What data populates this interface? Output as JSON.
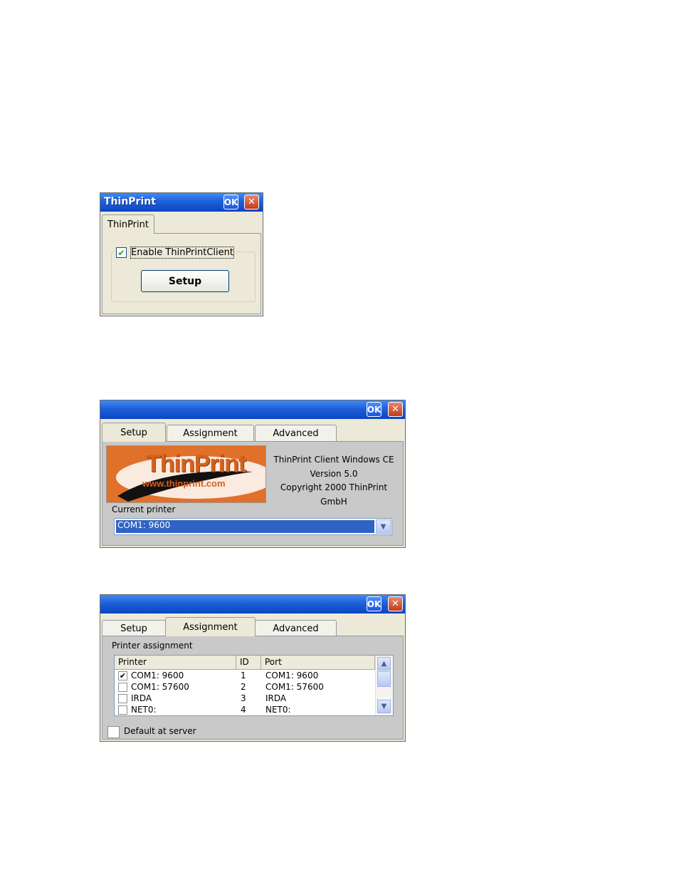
{
  "dialog1": {
    "title": "ThinPrint",
    "ok_label": "OK",
    "close_glyph": "✕",
    "tab_label": "ThinPrint",
    "enable_label": "Enable ThinPrintClient",
    "enable_checked": true,
    "check_glyph": "✔",
    "setup_button": "Setup"
  },
  "dialog2": {
    "ok_label": "OK",
    "close_glyph": "✕",
    "tabs": [
      {
        "label": "Setup"
      },
      {
        "label": "Assignment"
      },
      {
        "label": "Advanced"
      }
    ],
    "active_tab": "Setup",
    "logo_text": "ThinPrint",
    "logo_url": "www.thinprint.com",
    "info_lines": [
      "ThinPrint Client Windows CE",
      "Version 5.0",
      "Copyright 2000 ThinPrint GmbH"
    ],
    "current_printer_label": "Current printer",
    "current_printer_value": "COM1: 9600",
    "dropdown_glyph": "▼"
  },
  "dialog3": {
    "ok_label": "OK",
    "close_glyph": "✕",
    "tabs": [
      {
        "label": "Setup"
      },
      {
        "label": "Assignment"
      },
      {
        "label": "Advanced"
      }
    ],
    "active_tab": "Assignment",
    "group_label": "Printer assignment",
    "columns": [
      "Printer",
      "ID",
      "Port"
    ],
    "rows": [
      {
        "checked": true,
        "printer": "COM1: 9600",
        "id": "1",
        "port": "COM1: 9600"
      },
      {
        "checked": false,
        "printer": "COM1: 57600",
        "id": "2",
        "port": "COM1: 57600"
      },
      {
        "checked": false,
        "printer": "IRDA",
        "id": "3",
        "port": "IRDA"
      },
      {
        "checked": false,
        "printer": "NET0:",
        "id": "4",
        "port": "NET0:"
      }
    ],
    "row_check_glyph": "✔",
    "scroll_up_glyph": "▲",
    "scroll_down_glyph": "▼",
    "default_label": "Default at server",
    "default_checked": false
  },
  "colors": {
    "titlebar": "#0a46c4",
    "dialog_bg": "#ece9d8",
    "selection": "#3163c5",
    "logo_orange": "#e0702a"
  }
}
